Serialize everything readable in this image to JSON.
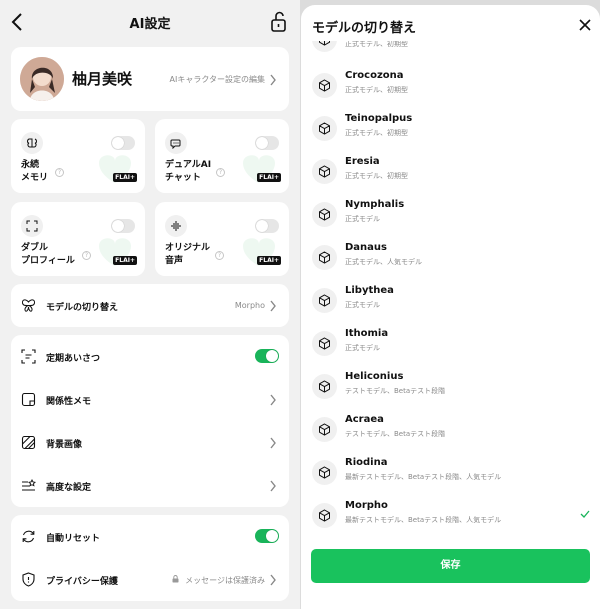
{
  "left": {
    "title": "AI設定",
    "profile": {
      "name": "柚月美咲",
      "edit_link": "AIキャラクター設定の編集"
    },
    "features": [
      {
        "label": "永続\nメモリ",
        "badge": "FLAI+",
        "enabled": false,
        "icon": "memory-icon"
      },
      {
        "label": "デュアルAI\nチャット",
        "badge": "FLAI+",
        "enabled": false,
        "icon": "dual-chat-icon"
      },
      {
        "label": "ダブル\nプロフィール",
        "badge": "FLAI+",
        "enabled": false,
        "icon": "double-profile-icon"
      },
      {
        "label": "オリジナル\n音声",
        "badge": "FLAI+",
        "enabled": false,
        "icon": "voice-icon"
      }
    ],
    "model_switch": {
      "label": "モデルの切り替え",
      "value": "Morpho"
    },
    "settings": [
      {
        "label": "定期あいさつ",
        "toggle": true
      },
      {
        "label": "関係性メモ"
      },
      {
        "label": "背景画像"
      },
      {
        "label": "高度な設定"
      }
    ],
    "reset": {
      "label": "自動リセット",
      "toggle": true
    },
    "privacy": {
      "label": "プライバシー保護",
      "value": "メッセージは保護済み"
    }
  },
  "sheet": {
    "title": "モデルの切り替え",
    "models": [
      {
        "name": "",
        "desc": "正式モデル、初期型"
      },
      {
        "name": "Crocozona",
        "desc": "正式モデル、初期型"
      },
      {
        "name": "Teinopalpus",
        "desc": "正式モデル、初期型"
      },
      {
        "name": "Eresia",
        "desc": "正式モデル、初期型"
      },
      {
        "name": "Nymphalis",
        "desc": "正式モデル"
      },
      {
        "name": "Danaus",
        "desc": "正式モデル、人気モデル"
      },
      {
        "name": "Libythea",
        "desc": "正式モデル"
      },
      {
        "name": "Ithomia",
        "desc": "正式モデル"
      },
      {
        "name": "Heliconius",
        "desc": "テストモデル、Betaテスト段階"
      },
      {
        "name": "Acraea",
        "desc": "テストモデル、Betaテスト段階"
      },
      {
        "name": "Riodina",
        "desc": "最新テストモデル、Betaテスト段階、人気モデル"
      },
      {
        "name": "Morpho",
        "desc": "最新テストモデル、Betaテスト段階、人気モデル",
        "selected": true
      }
    ],
    "save_label": "保存"
  },
  "colors": {
    "accent": "#19c25d",
    "toggle_on": "#19b45a",
    "badge": "#111111"
  }
}
